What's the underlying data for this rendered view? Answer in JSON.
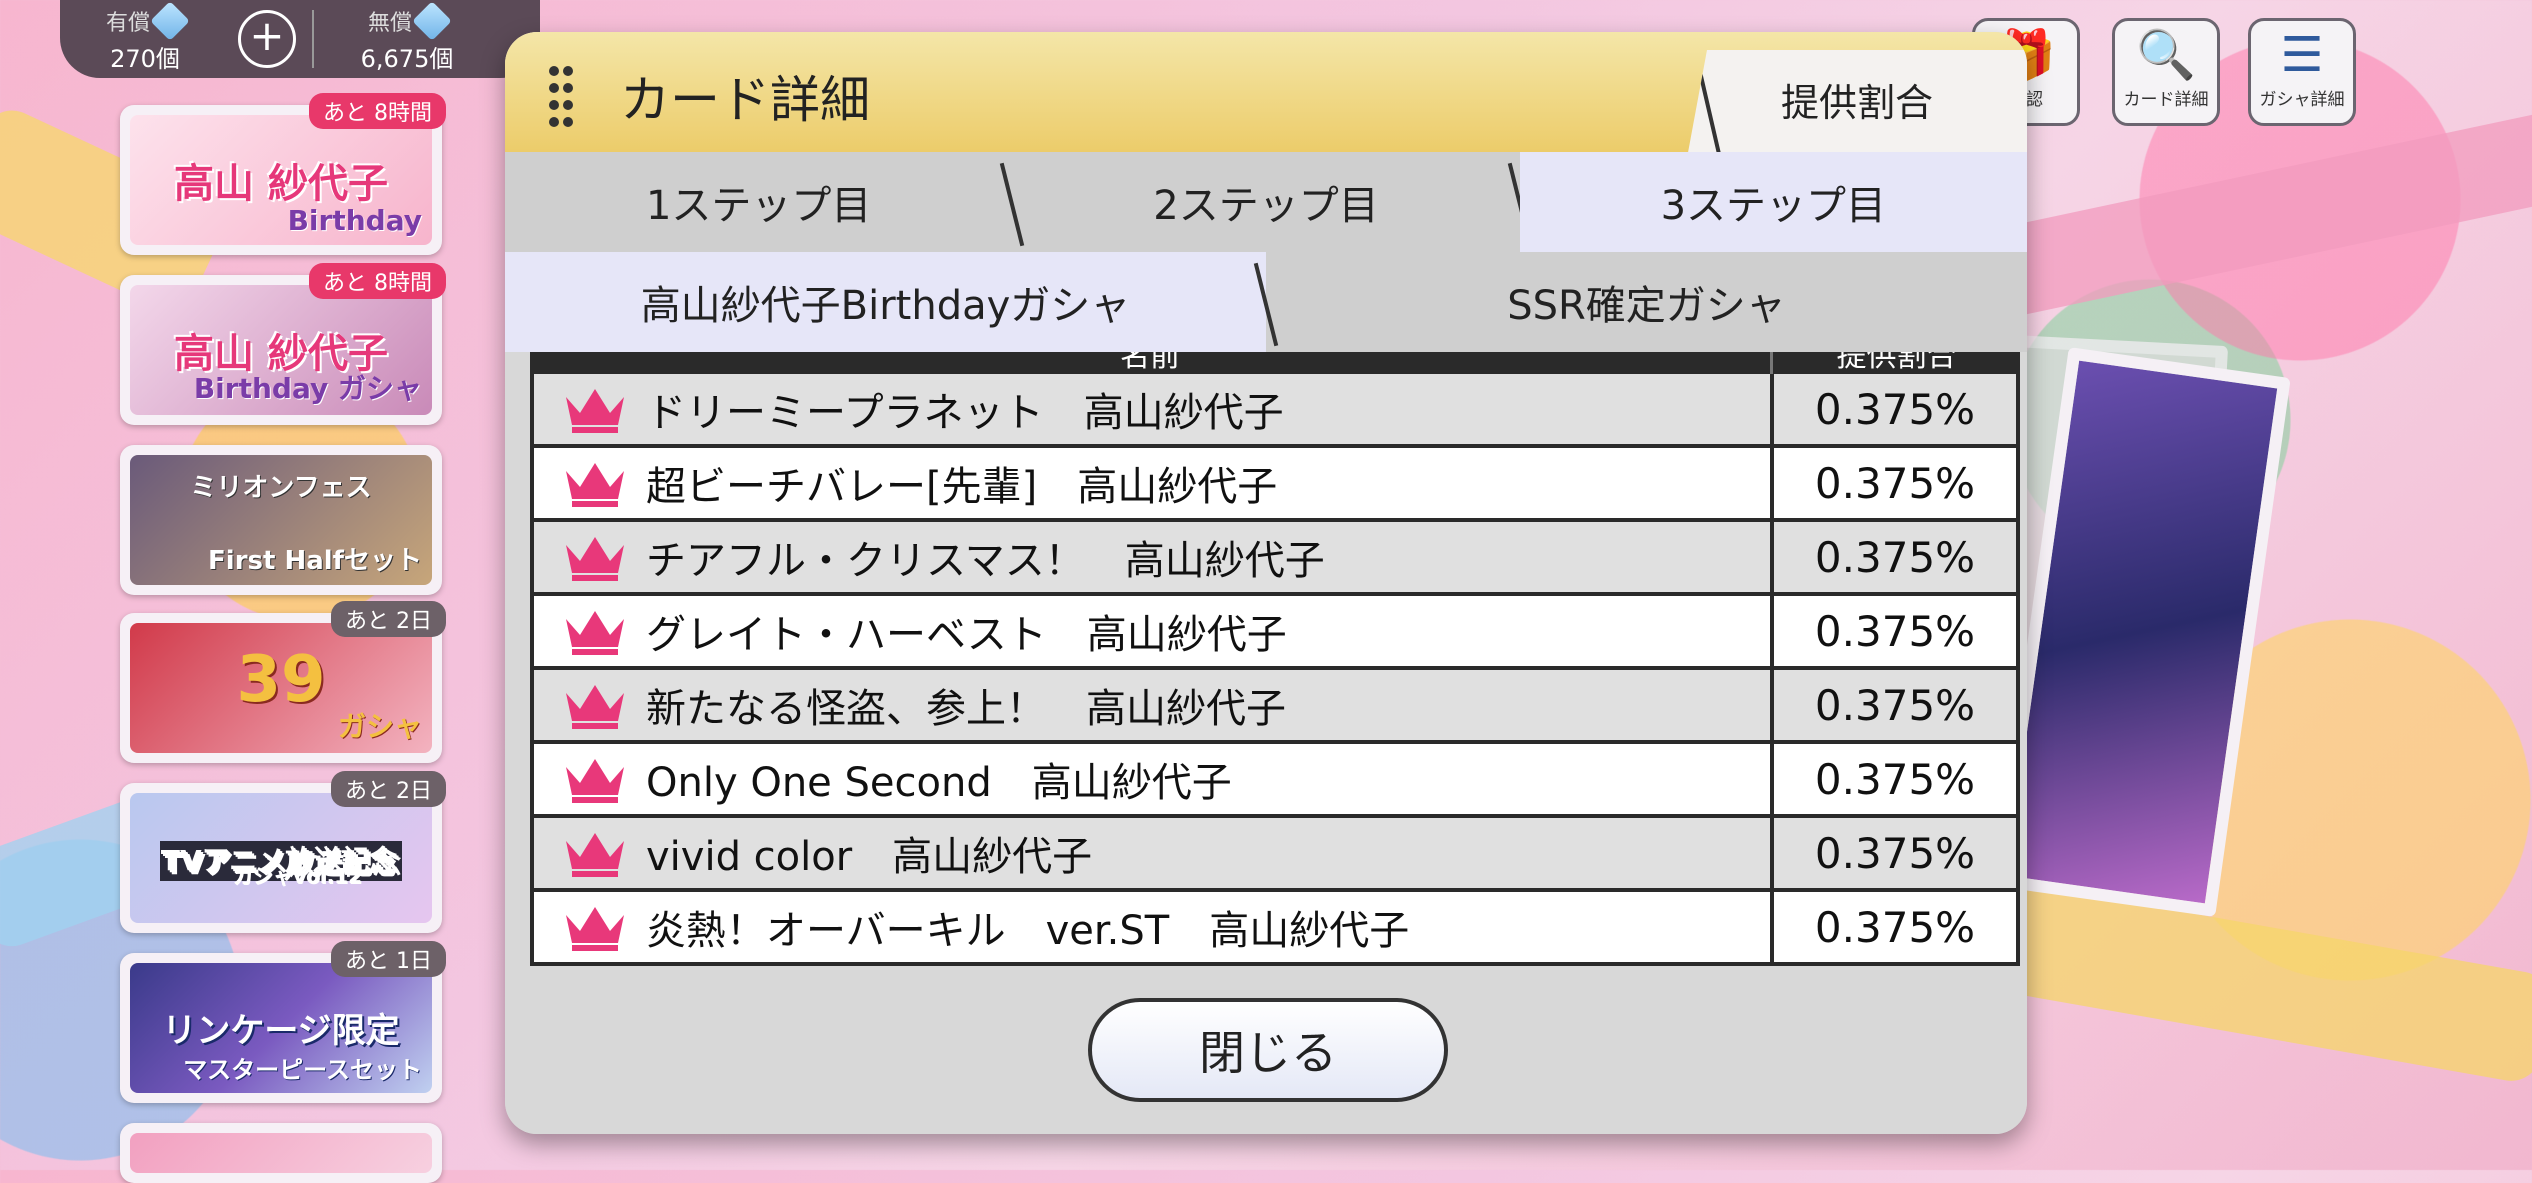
{
  "currency": {
    "paid_label": "有償",
    "paid_value": "270個",
    "free_label": "無償",
    "free_value": "6,675個",
    "add_symbol": "+"
  },
  "banners": [
    {
      "badge": "あと 8時間",
      "title": "高山 紗代子",
      "sub": "Birthday",
      "badge_color": "#e8386a"
    },
    {
      "badge": "あと 8時間",
      "title": "高山 紗代子",
      "sub": "Birthday ガシャ",
      "badge_color": "#e8386a"
    },
    {
      "badge": "",
      "title": "ミリオンフェス",
      "sub": "First Halfセット",
      "badge_color": ""
    },
    {
      "badge": "あと 2日",
      "title": "39",
      "sub": "ガシャ",
      "badge_color": "#6d6168"
    },
    {
      "badge": "あと 2日",
      "title": "TVアニメ放送記念",
      "sub": "ガシャvol.12",
      "badge_color": "#6d6168"
    },
    {
      "badge": "あと 1日",
      "title": "リンケージ限定",
      "sub": "マスターピースセット",
      "badge_color": "#6d6168"
    }
  ],
  "top_buttons": [
    {
      "label": "確認",
      "icon": "gift-icon"
    },
    {
      "label": "カード詳細",
      "icon": "card-search-icon"
    },
    {
      "label": "ガシャ詳細",
      "icon": "list-search-icon"
    }
  ],
  "modal": {
    "title": "カード詳細",
    "rate_tab": "提供割合",
    "step_tabs": [
      "1ステップ目",
      "2ステップ目",
      "3ステップ目"
    ],
    "active_step": 2,
    "gacha_tabs": [
      "高山紗代子Birthdayガシャ",
      "SSR確定ガシャ"
    ],
    "active_gacha": 0,
    "table": {
      "col_name": "名前",
      "col_rate": "提供割合",
      "rows": [
        {
          "name": "ドリーミープラネット　高山紗代子",
          "rate": "0.375%"
        },
        {
          "name": "超ビーチバレー[先輩]　高山紗代子",
          "rate": "0.375%"
        },
        {
          "name": "チアフル・クリスマス！　高山紗代子",
          "rate": "0.375%"
        },
        {
          "name": "グレイト・ハーベスト　高山紗代子",
          "rate": "0.375%"
        },
        {
          "name": "新たなる怪盗、参上！　高山紗代子",
          "rate": "0.375%"
        },
        {
          "name": "Only One Second　高山紗代子",
          "rate": "0.375%"
        },
        {
          "name": "vivid color　高山紗代子",
          "rate": "0.375%"
        },
        {
          "name": "炎熱！オーバーキル　ver.ST　高山紗代子",
          "rate": "0.375%"
        }
      ]
    },
    "close_label": "閉じる"
  },
  "colors": {
    "header": "#eccc6a",
    "crown": "#e8387a",
    "active_tab": "#e6e6f8"
  }
}
